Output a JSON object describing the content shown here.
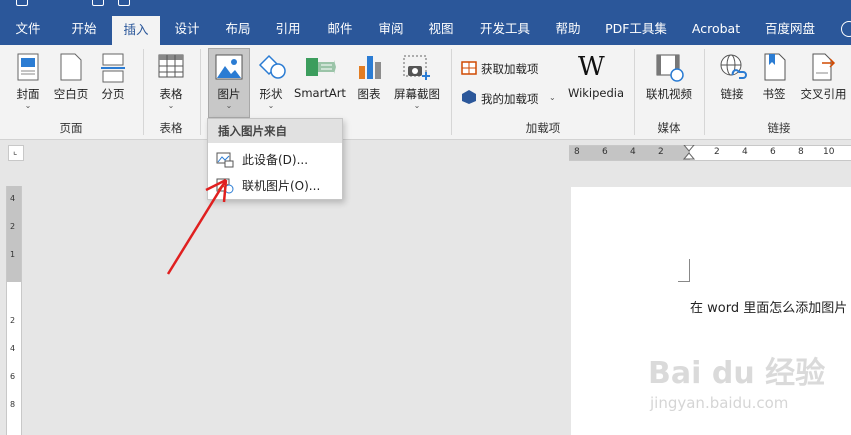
{
  "ribbon_tabs": [
    "文件",
    "开始",
    "插入",
    "设计",
    "布局",
    "引用",
    "邮件",
    "审阅",
    "视图",
    "开发工具",
    "帮助",
    "PDF工具集",
    "Acrobat",
    "百度网盘"
  ],
  "active_tab": "插入",
  "groups": {
    "pages": {
      "label": "页面",
      "buttons": [
        "封面",
        "空白页",
        "分页"
      ]
    },
    "tables": {
      "label": "表格",
      "buttons": [
        "表格"
      ]
    },
    "illustrations": {
      "buttons": [
        "图片",
        "形状",
        "SmartArt",
        "图表",
        "屏幕截图"
      ]
    },
    "addins": {
      "label": "加载项",
      "get": "获取加载项",
      "mine": "我的加载项",
      "wiki": "Wikipedia"
    },
    "media": {
      "label": "媒体",
      "buttons": [
        "联机视频"
      ]
    },
    "links": {
      "label": "链接",
      "buttons": [
        "链接",
        "书签",
        "交叉引用"
      ]
    }
  },
  "dropdown": {
    "header": "插入图片来自",
    "items": [
      "此设备(D)...",
      "联机图片(O)..."
    ]
  },
  "hruler": [
    "8",
    "6",
    "4",
    "2",
    "2",
    "4",
    "6",
    "8",
    "10"
  ],
  "vruler": [
    "4",
    "2",
    "1",
    "2",
    "4",
    "6",
    "8"
  ],
  "document_text": "在 word 里面怎么添加图片",
  "watermark": {
    "main": "Bai du 经验",
    "sub": "jingyan.baidu.com"
  },
  "colors": {
    "word_blue": "#2b579a",
    "arrow": "#e02020"
  }
}
